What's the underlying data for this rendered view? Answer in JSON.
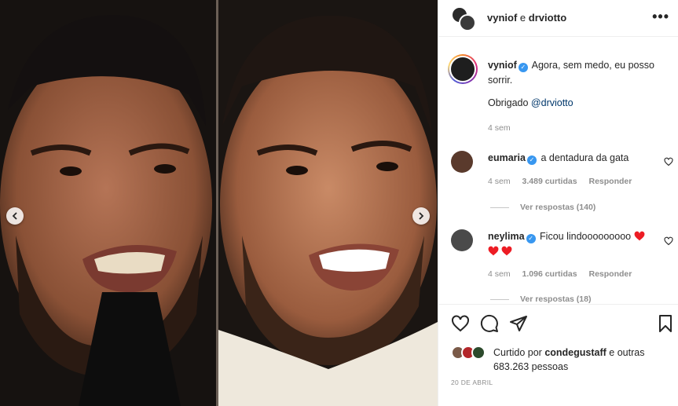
{
  "post": {
    "header_user1": "vyniof",
    "header_conj": "e",
    "header_user2": "drviotto",
    "more_label": "•••"
  },
  "caption": {
    "username": "vyniof",
    "text": "Agora, sem medo, eu posso sorrir.",
    "thanks_prefix": "Obrigado",
    "thanks_mention": "@drviotto",
    "time": "4 sem"
  },
  "comments": [
    {
      "username": "eumaria",
      "text": "a dentadura da gata",
      "time": "4 sem",
      "likes": "3.489 curtidas",
      "reply_label": "Responder",
      "replies": "Ver respostas (140)"
    },
    {
      "username": "neylima",
      "text": "Ficou lindooooooooo",
      "time": "4 sem",
      "likes": "1.096 curtidas",
      "reply_label": "Responder",
      "replies": "Ver respostas (18)"
    }
  ],
  "actions": {
    "icons": [
      "heart-icon",
      "comment-icon",
      "share-icon",
      "bookmark-icon"
    ]
  },
  "likes": {
    "prefix": "Curtido por",
    "user": "condegustaff",
    "conj": "e",
    "others": "outras 683.263 pessoas"
  },
  "date": "20 DE ABRIL",
  "colors": {
    "verified": "#3897f0",
    "mention": "#00376b",
    "meta": "#8e8e8e",
    "heart_emoji": "#ed1c24"
  }
}
